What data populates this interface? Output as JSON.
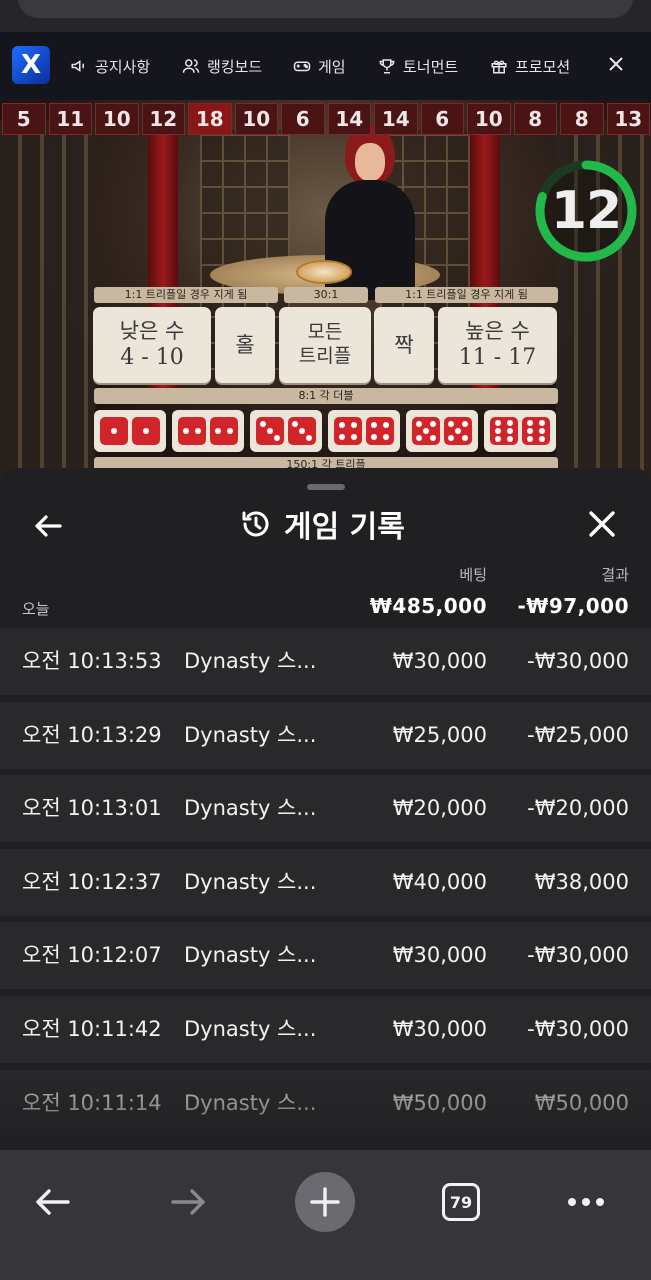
{
  "nav": {
    "logo_text": "X",
    "items": [
      {
        "label": "공지사항",
        "icon": "megaphone-icon"
      },
      {
        "label": "랭킹보드",
        "icon": "users-icon"
      },
      {
        "label": "게임",
        "icon": "gamepad-icon"
      },
      {
        "label": "토너먼트",
        "icon": "trophy-icon"
      },
      {
        "label": "프로모션",
        "icon": "gift-icon"
      }
    ]
  },
  "game": {
    "streak": [
      "5",
      "11",
      "10",
      "12",
      "18",
      "10",
      "6",
      "14",
      "14",
      "6",
      "10",
      "8",
      "8",
      "13"
    ],
    "timer": "12",
    "timer_progress": 0.8,
    "payouts": {
      "small_payout": "1:1 트리플일 경우 지게 됨",
      "triple_payout": "30:1",
      "big_payout": "1:1 트리플일 경우 지게 됨",
      "double_payout": "8:1 각 더블",
      "specific_triple_payout": "150:1 각 트리플"
    },
    "bets": {
      "small_label": "낮은 수",
      "small_range": "4 - 10",
      "odd_label": "홀",
      "any_triple_line1": "모든",
      "any_triple_line2": "트리플",
      "even_label": "짝",
      "big_label": "높은 수",
      "big_range": "11 - 17"
    }
  },
  "history": {
    "title": "게임 기록",
    "col_bet": "베팅",
    "col_result": "결과",
    "today_label": "오늘",
    "today_bet": "₩485,000",
    "today_result": "-₩97,000",
    "rows": [
      {
        "time": "오전 10:13:53",
        "game": "Dynasty 스...",
        "bet": "₩30,000",
        "result": "-₩30,000"
      },
      {
        "time": "오전 10:13:29",
        "game": "Dynasty 스...",
        "bet": "₩25,000",
        "result": "-₩25,000"
      },
      {
        "time": "오전 10:13:01",
        "game": "Dynasty 스...",
        "bet": "₩20,000",
        "result": "-₩20,000"
      },
      {
        "time": "오전 10:12:37",
        "game": "Dynasty 스...",
        "bet": "₩40,000",
        "result": "₩38,000"
      },
      {
        "time": "오전 10:12:07",
        "game": "Dynasty 스...",
        "bet": "₩30,000",
        "result": "-₩30,000"
      },
      {
        "time": "오전 10:11:42",
        "game": "Dynasty 스...",
        "bet": "₩30,000",
        "result": "-₩30,000"
      },
      {
        "time": "오전 10:11:14",
        "game": "Dynasty 스...",
        "bet": "₩50,000",
        "result": "₩50,000"
      }
    ]
  },
  "browser": {
    "tab_count": "79"
  }
}
